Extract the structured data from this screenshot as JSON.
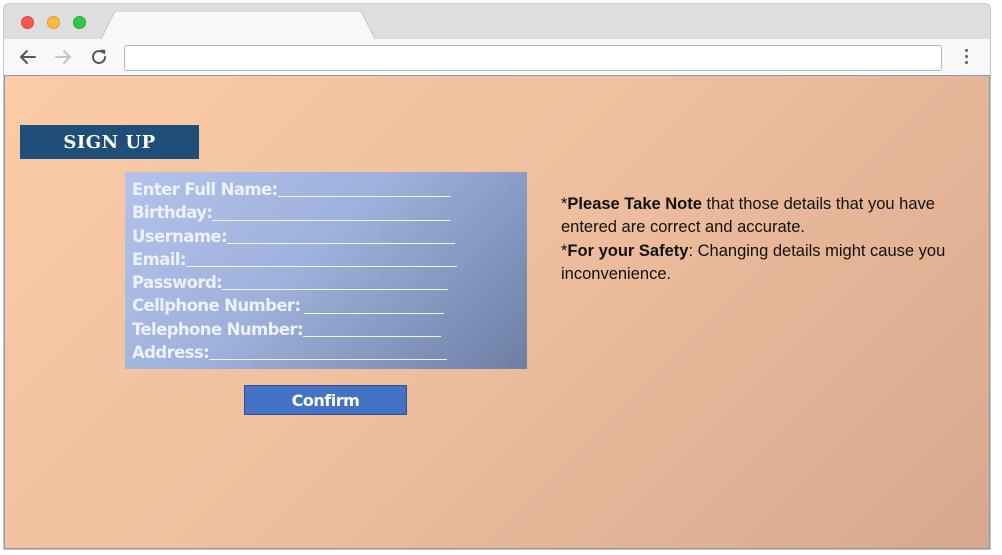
{
  "window": {
    "controls": [
      "close",
      "minimize",
      "maximize"
    ],
    "address_value": "",
    "menu_icon": "more-vert-icon"
  },
  "toolbar": {
    "back_icon": "arrow-left-icon",
    "forward_icon": "arrow-right-icon",
    "reload_icon": "reload-icon"
  },
  "page": {
    "signup_label": "SIGN UP",
    "form": {
      "fields": [
        {
          "label": "Enter Full Name:"
        },
        {
          "label": "Birthday:"
        },
        {
          "label": "Username:"
        },
        {
          "label": "Email:"
        },
        {
          "label": "Password:"
        },
        {
          "label": "Cellphone Number:"
        },
        {
          "label": "Telephone Number:"
        },
        {
          "label": "Address:"
        }
      ]
    },
    "confirm_label": "Confirm",
    "note": {
      "star1": "*",
      "bold1": "Please Take Note",
      "text1": " that those details that you have entered are correct and accurate.",
      "star2": "*",
      "bold2": "For your Safety",
      "text2": ": Changing details might cause you inconvenience."
    }
  },
  "colors": {
    "banner": "#1f4e79",
    "confirm": "#4472c4",
    "page_bg": "#f5c4a2",
    "form_bg": "#9eb1dc"
  }
}
